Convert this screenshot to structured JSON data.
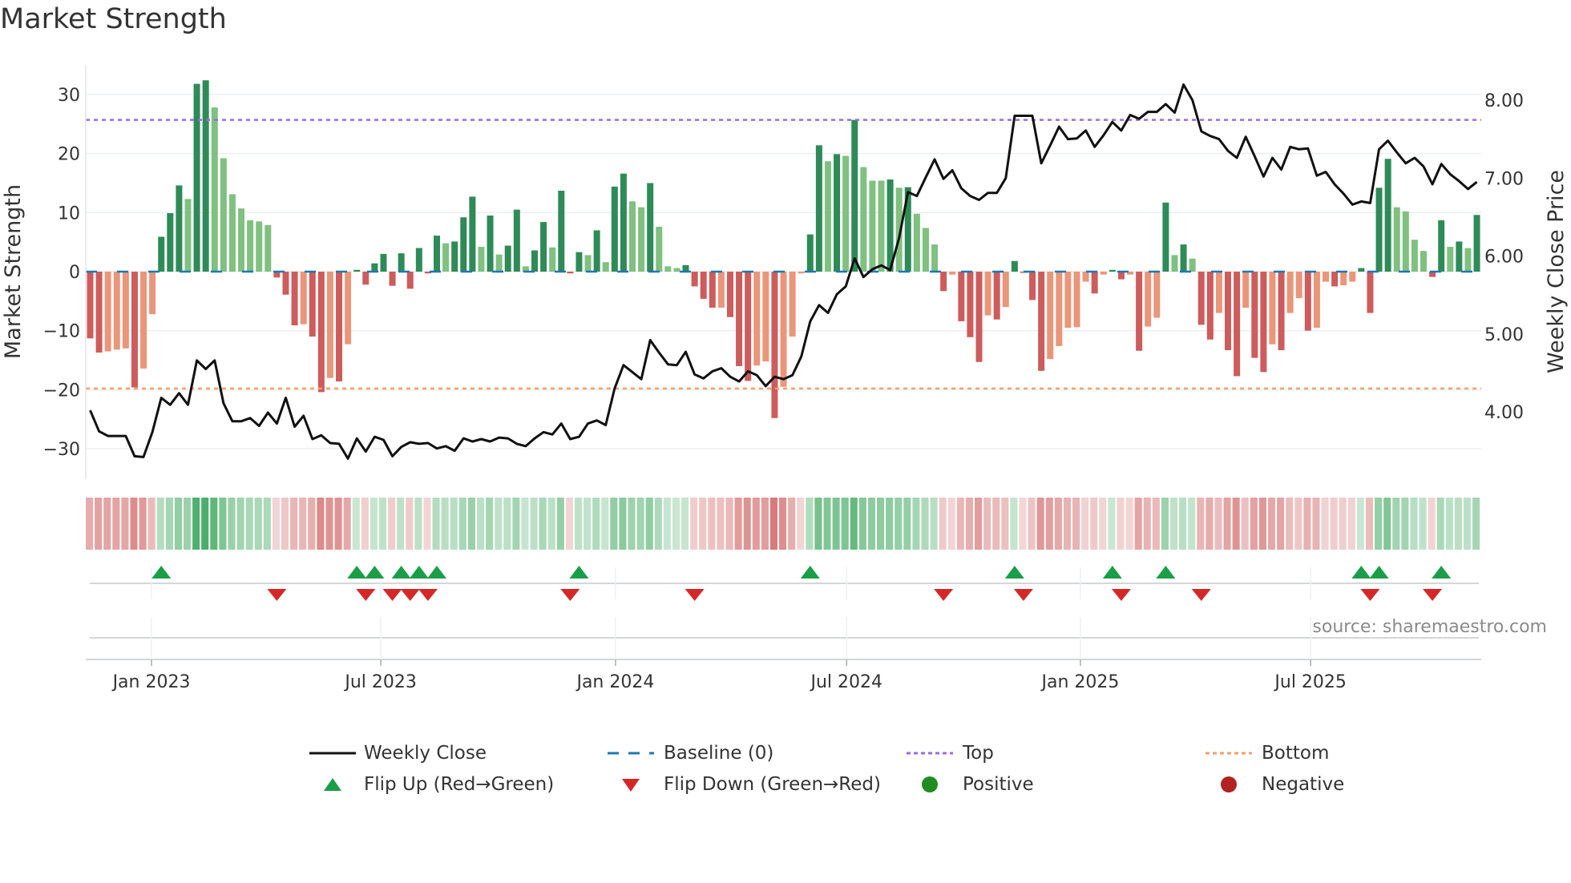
{
  "title": "Market Strength",
  "source": "source: sharemaestro.com",
  "colors": {
    "green_dark": "#2e8b57",
    "green_light": "#80c080",
    "red_dark": "#cd5c5c",
    "red_light": "#e9967a",
    "baseline": "#1f77b4",
    "top": "#9b6be0",
    "bottom": "#f0a070",
    "line": "#111111",
    "flip_up": "#1a9e48",
    "flip_down": "#d62728",
    "positive": "#228b22",
    "negative": "#b22222"
  },
  "legend": {
    "weekly_close": "Weekly Close",
    "baseline": "Baseline (0)",
    "top": "Top",
    "bottom": "Bottom",
    "flip_up": "Flip Up (Red→Green)",
    "flip_down": "Flip Down (Green→Red)",
    "positive": "Positive",
    "negative": "Negative"
  },
  "chart_data": {
    "type": "bar+line",
    "title": "Market Strength",
    "ylabel": "Market Strength",
    "y2label": "Weekly Close Price",
    "ylim": [
      -33.5,
      36
    ],
    "y2lim": [
      3.14,
      8.64
    ],
    "y_ticks": [
      "30",
      "20",
      "10",
      "0",
      "−10",
      "−20",
      "−30"
    ],
    "y_tick_values": [
      30,
      20,
      10,
      0,
      -10,
      -20,
      -30
    ],
    "y2_ticks": [
      "8.00",
      "7.00",
      "6.00",
      "5.00",
      "4.00"
    ],
    "y2_tick_values": [
      8,
      7,
      6,
      5,
      4
    ],
    "x_ticks": [
      "Jan 2023",
      "Jul 2023",
      "Jan 2024",
      "Jul 2024",
      "Jan 2025",
      "Jul 2025"
    ],
    "x_tick_week_index": [
      6.9,
      32.7,
      59.1,
      85.1,
      111.4,
      137.3
    ],
    "top_level": 25.7,
    "bottom_level": -19.8,
    "baseline": 0,
    "strength": [
      -11.3,
      -13.7,
      -13.5,
      -13.2,
      -13.0,
      -19.6,
      -16.4,
      -7.2,
      5.9,
      9.9,
      14.6,
      12.3,
      31.8,
      32.4,
      27.8,
      19.2,
      13.1,
      10.7,
      8.7,
      8.5,
      7.9,
      -1.0,
      -3.9,
      -9.1,
      -8.9,
      -11.0,
      -20.4,
      -18.0,
      -18.6,
      -12.3,
      0.3,
      -2.2,
      1.4,
      3.0,
      -2.4,
      3.1,
      -2.9,
      4.0,
      -0.3,
      6.1,
      4.8,
      5.1,
      9.2,
      12.7,
      4.2,
      9.5,
      2.9,
      4.4,
      10.5,
      0.9,
      3.6,
      8.4,
      4.1,
      13.7,
      -0.3,
      3.3,
      2.8,
      7.0,
      1.6,
      14.4,
      16.6,
      11.9,
      10.9,
      15.0,
      7.6,
      0.9,
      0.6,
      1.1,
      -2.5,
      -4.6,
      -6.1,
      -6.1,
      -7.7,
      -16.0,
      -18.5,
      -15.9,
      -15.2,
      -24.8,
      -19.5,
      -11.0,
      -0.3,
      6.3,
      21.4,
      18.7,
      19.9,
      19.6,
      25.7,
      17.7,
      15.4,
      15.4,
      15.6,
      14.2,
      14.3,
      9.8,
      7.4,
      4.6,
      -3.3,
      -0.5,
      -8.4,
      -11.1,
      -15.3,
      -7.4,
      -8.1,
      -6.0,
      1.8,
      -0.2,
      -4.8,
      -16.8,
      -14.8,
      -12.6,
      -9.5,
      -9.4,
      -1.7,
      -3.7,
      -0.5,
      0.3,
      -1.3,
      -0.5,
      -13.4,
      -9.3,
      -7.8,
      11.7,
      2.8,
      4.6,
      2.2,
      -9.0,
      -11.5,
      -7.0,
      -13.3,
      -17.7,
      -6.1,
      -14.6,
      -17.0,
      -12.3,
      -13.3,
      -7.0,
      -4.5,
      -10.0,
      -9.5,
      -1.7,
      -2.5,
      -2.3,
      -1.7,
      0.6,
      -7.0,
      14.2,
      19.1,
      10.9,
      10.2,
      5.4,
      3.5,
      -0.9,
      8.7,
      4.2,
      5.1,
      4.0,
      9.6
    ],
    "weekly_close": [
      4.02,
      3.75,
      3.69,
      3.69,
      3.69,
      3.43,
      3.42,
      3.74,
      4.18,
      4.09,
      4.24,
      4.09,
      4.66,
      4.55,
      4.66,
      4.11,
      3.88,
      3.88,
      3.92,
      3.82,
      3.99,
      3.85,
      4.18,
      3.81,
      3.95,
      3.65,
      3.7,
      3.6,
      3.59,
      3.4,
      3.66,
      3.49,
      3.68,
      3.64,
      3.43,
      3.55,
      3.61,
      3.59,
      3.6,
      3.53,
      3.56,
      3.5,
      3.66,
      3.62,
      3.65,
      3.62,
      3.67,
      3.66,
      3.59,
      3.56,
      3.66,
      3.74,
      3.71,
      3.85,
      3.65,
      3.68,
      3.85,
      3.89,
      3.83,
      4.3,
      4.6,
      4.51,
      4.42,
      4.92,
      4.76,
      4.61,
      4.6,
      4.77,
      4.48,
      4.43,
      4.52,
      4.56,
      4.45,
      4.39,
      4.52,
      4.47,
      4.33,
      4.45,
      4.42,
      4.47,
      4.71,
      5.16,
      5.37,
      5.27,
      5.51,
      5.61,
      5.97,
      5.73,
      5.83,
      5.88,
      5.82,
      6.23,
      6.82,
      6.77,
      7.01,
      7.24,
      6.99,
      7.1,
      6.87,
      6.77,
      6.72,
      6.81,
      6.81,
      7.0,
      7.8,
      7.8,
      7.8,
      7.19,
      7.42,
      7.66,
      7.5,
      7.51,
      7.61,
      7.4,
      7.55,
      7.72,
      7.61,
      7.81,
      7.76,
      7.85,
      7.85,
      7.95,
      7.84,
      8.2,
      8.0,
      7.6,
      7.54,
      7.5,
      7.35,
      7.26,
      7.53,
      7.28,
      7.02,
      7.26,
      7.11,
      7.4,
      7.37,
      7.38,
      7.03,
      7.08,
      6.92,
      6.8,
      6.66,
      6.7,
      6.68,
      7.37,
      7.48,
      7.33,
      7.19,
      7.26,
      7.15,
      6.92,
      7.18,
      7.05,
      6.96,
      6.86,
      6.95
    ]
  }
}
